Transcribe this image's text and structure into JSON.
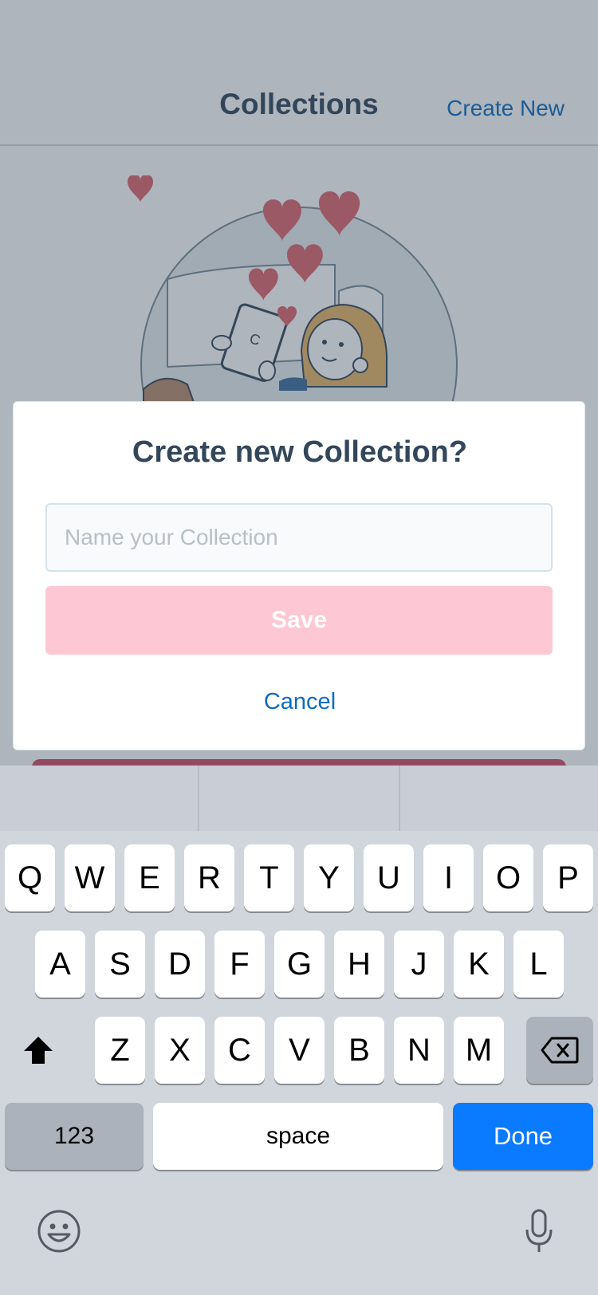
{
  "header": {
    "title": "Collections",
    "create_new": "Create New"
  },
  "modal": {
    "title": "Create new Collection?",
    "input_placeholder": "Name your Collection",
    "input_value": "",
    "save_label": "Save",
    "cancel_label": "Cancel"
  },
  "keyboard": {
    "row1": [
      "Q",
      "W",
      "E",
      "R",
      "T",
      "Y",
      "U",
      "I",
      "O",
      "P"
    ],
    "row2": [
      "A",
      "S",
      "D",
      "F",
      "G",
      "H",
      "J",
      "K",
      "L"
    ],
    "row3": [
      "Z",
      "X",
      "C",
      "V",
      "B",
      "N",
      "M"
    ],
    "numbers_label": "123",
    "space_label": "space",
    "done_label": "Done"
  },
  "icons": {
    "shift": "shift-icon",
    "backspace": "backspace-icon",
    "emoji": "emoji-icon",
    "mic": "microphone-icon"
  },
  "colors": {
    "accent_link": "#0a6cc4",
    "save_disabled": "#fdc8d3",
    "done_key": "#0a7aff",
    "title_text": "#33475b"
  }
}
